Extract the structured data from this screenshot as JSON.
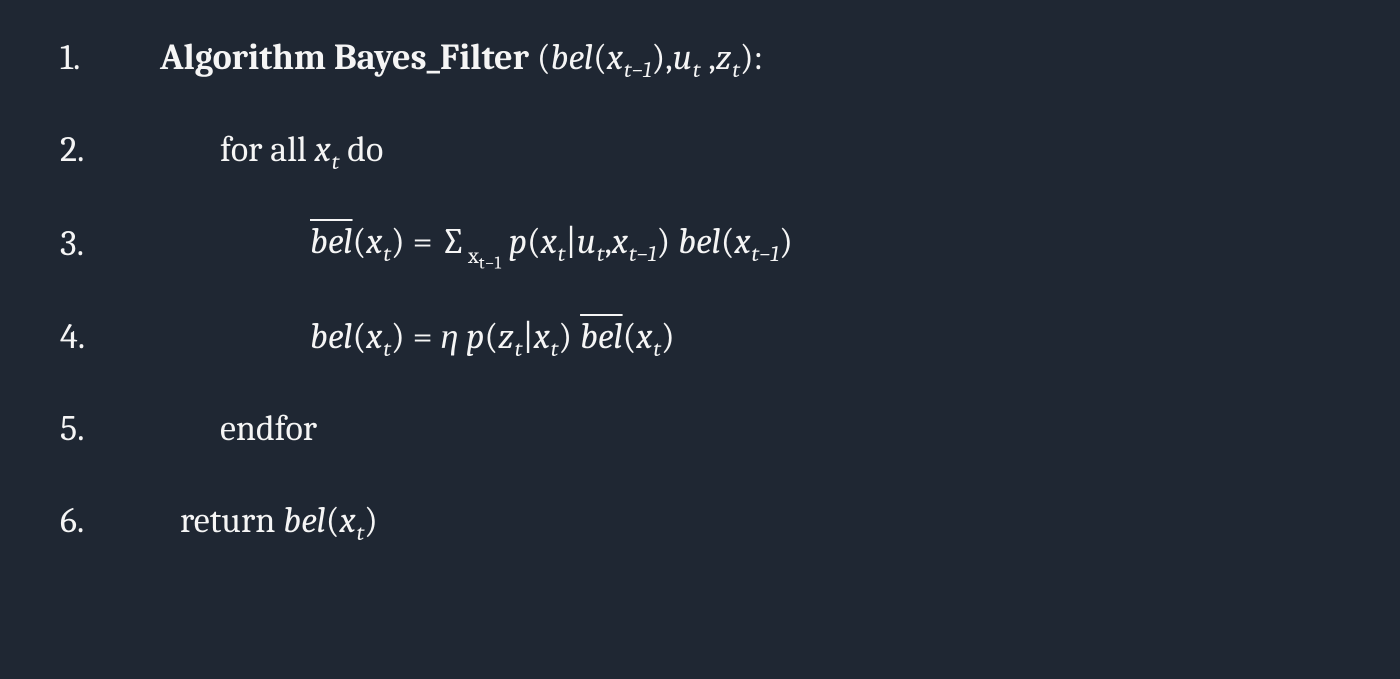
{
  "algorithm": {
    "name": "Bayes_Filter",
    "title_prefix": "Algorithm Bayes_Filter",
    "args_open": " (",
    "args_close": "):",
    "args": {
      "bel_label": "bel",
      "x_label": "x",
      "u_label": "u",
      "z_label": "z",
      "sub_t": "t",
      "sub_tm1": "t−1"
    },
    "lines": {
      "l1": {
        "n": "1."
      },
      "l2": {
        "n": "2.",
        "forall": "for all ",
        "do": " do"
      },
      "l3": {
        "n": "3.",
        "bel": "bel",
        "x": "x",
        "eq": " =  ",
        "sum": "∑",
        "p": "p",
        "u": "u",
        "pipe": "|",
        "comma": ",",
        "sp": "  "
      },
      "l4": {
        "n": "4.",
        "bel": "bel",
        "x": "x",
        "eq": "  =  ",
        "eta": "η ",
        "p": "p",
        "z": "z",
        "pipe": "|",
        "sp": "  "
      },
      "l5": {
        "n": "5.",
        "endfor": "endfor"
      },
      "l6": {
        "n": "6.",
        "return": "return ",
        "bel": "bel",
        "x": "x"
      }
    },
    "subs": {
      "t": "t",
      "tm1": "t−1"
    }
  }
}
